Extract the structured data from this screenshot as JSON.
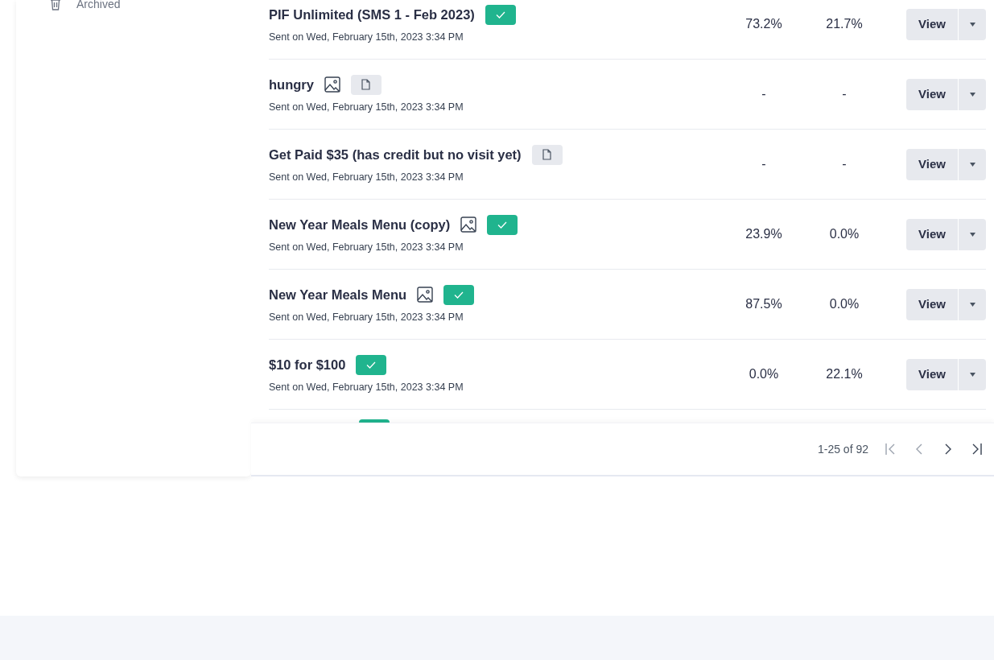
{
  "sidebar": {
    "items": [
      {
        "label": "Archived"
      }
    ]
  },
  "rows": [
    {
      "title": "PIF Unlimited (SMS 1 - Feb 2023)",
      "subtitle": "Sent on Wed, February 15th, 2023 3:34 PM",
      "badges": [
        {
          "kind": "check"
        }
      ],
      "column_1": "73.2%",
      "column_2": "21.7%",
      "button": "View"
    },
    {
      "title": "hungry",
      "subtitle": "Sent on Wed, February 15th, 2023 3:34 PM",
      "badges": [
        {
          "kind": "image"
        },
        {
          "kind": "document"
        }
      ],
      "column_1": "-",
      "column_2": "-",
      "button": "View"
    },
    {
      "title": "Get Paid $35 (has credit but no visit yet)",
      "subtitle": "Sent on Wed, February 15th, 2023 3:34 PM",
      "badges": [
        {
          "kind": "document"
        }
      ],
      "column_1": "-",
      "column_2": "-",
      "button": "View"
    },
    {
      "title": "New Year Meals Menu (copy)",
      "subtitle": "Sent on Wed, February 15th, 2023 3:34 PM",
      "badges": [
        {
          "kind": "image"
        },
        {
          "kind": "check"
        }
      ],
      "column_1": "23.9%",
      "column_2": "0.0%",
      "button": "View"
    },
    {
      "title": "New Year Meals Menu",
      "subtitle": "Sent on Wed, February 15th, 2023 3:34 PM",
      "badges": [
        {
          "kind": "image"
        },
        {
          "kind": "check"
        }
      ],
      "column_1": "87.5%",
      "column_2": "0.0%",
      "button": "View"
    },
    {
      "title": "$10 for $100",
      "subtitle": "Sent on Wed, February 15th, 2023 3:34 PM",
      "badges": [
        {
          "kind": "check"
        }
      ],
      "column_1": "0.0%",
      "column_2": "22.1%",
      "button": "View"
    }
  ],
  "partial_row": {
    "badges": [
      {
        "kind": "check"
      }
    ]
  },
  "pagination": {
    "range": "1-25 of 92"
  }
}
